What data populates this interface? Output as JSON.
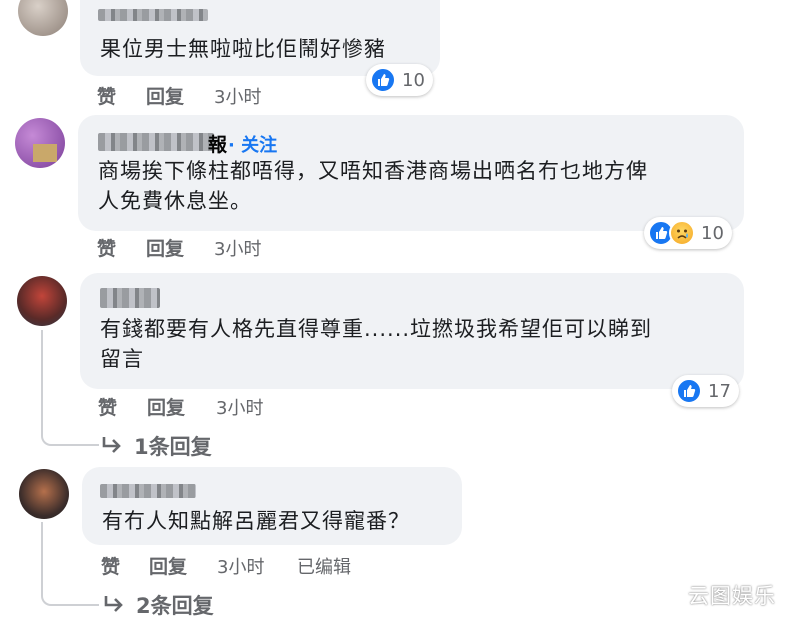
{
  "comments": [
    {
      "text": "果位男士無啦啦比佢鬧好慘豬",
      "actions": {
        "like": "赞",
        "reply": "回复",
        "time": "3小时"
      },
      "reaction_count": "10"
    },
    {
      "name_suffix": "報",
      "follow": "· 关注",
      "text_line1": "商場挨下條柱都唔得，又唔知香港商場出哂名冇乜地方俾",
      "text_line2": "人免費休息坐。",
      "actions": {
        "like": "赞",
        "reply": "回复",
        "time": "3小时"
      },
      "reaction_count": "10"
    },
    {
      "text_line1": "有錢都要有人格先直得尊重......垃撚圾我希望佢可以睇到",
      "text_line2": "留言",
      "actions": {
        "like": "赞",
        "reply": "回复",
        "time": "3小时"
      },
      "reaction_count": "17",
      "replies": "1条回复"
    },
    {
      "text": "有冇人知點解呂麗君又得寵番？",
      "actions": {
        "like": "赞",
        "reply": "回复",
        "time": "3小时",
        "edited": "已编辑"
      },
      "replies": "2条回复"
    }
  ],
  "watermark": "云图娱乐",
  "colors": {
    "bubble": "#f0f2f5",
    "link": "#1877f2",
    "muted": "#65676b"
  },
  "icons": [
    "like-icon",
    "sad-icon",
    "reply-arrow-icon"
  ]
}
